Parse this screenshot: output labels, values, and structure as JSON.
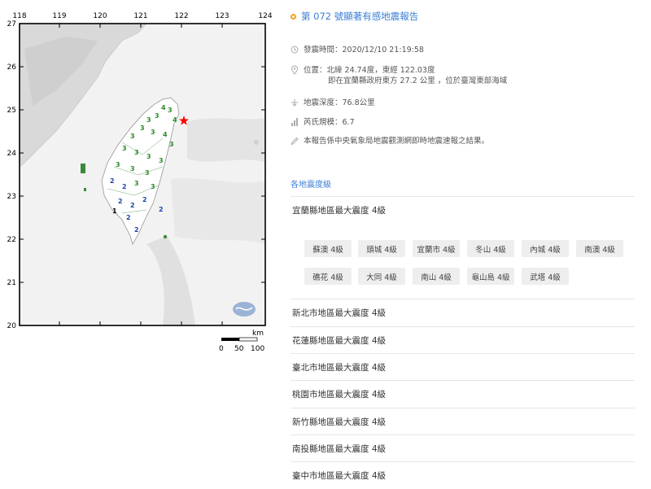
{
  "map": {
    "x_ticks": [
      "118",
      "119",
      "120",
      "121",
      "122",
      "123",
      "124"
    ],
    "y_ticks": [
      "27",
      "26",
      "25",
      "24",
      "23",
      "22",
      "21",
      "20"
    ],
    "scale_unit": "km",
    "scale_ticks": [
      "0",
      "50",
      "100"
    ]
  },
  "report": {
    "title": "第 072 號顯著有感地震報告",
    "time_label": "發震時間：2020/12/10 21:19:58",
    "location_line1": "位置：北緯 24.74度，東經 122.03度",
    "location_line2": "即在宜蘭縣政府東方 27.2 公里 ，位於臺灣東部海域",
    "depth_label": "地震深度：76.8公里",
    "magnitude_label": "芮氏規模：6.7",
    "note": "本報告係中央氣象局地震觀測網即時地震速報之結果。",
    "section_title": "各地震度級",
    "expanded_region": "宜蘭縣地區最大震度 4級",
    "town_items": [
      "蘇澳 4級",
      "頭城 4級",
      "宜蘭市 4級",
      "冬山 4級",
      "內城 4級",
      "南澳 4級",
      "礁花 4級",
      "大同 4級",
      "南山 4級",
      "龜山島 4級",
      "武塔 4級"
    ],
    "other_regions": [
      "新北市地區最大震度 4級",
      "花蓮縣地區最大震度 4級",
      "臺北市地區最大震度 4級",
      "桃園市地區最大震度 4級",
      "新竹縣地區最大震度 4級",
      "南投縣地區最大震度 4級",
      "臺中市地區最大震度 4級"
    ]
  },
  "colors": {
    "title": "#3a7fd5",
    "dot": "#f0a21a",
    "epicenter": "#ff0000"
  }
}
